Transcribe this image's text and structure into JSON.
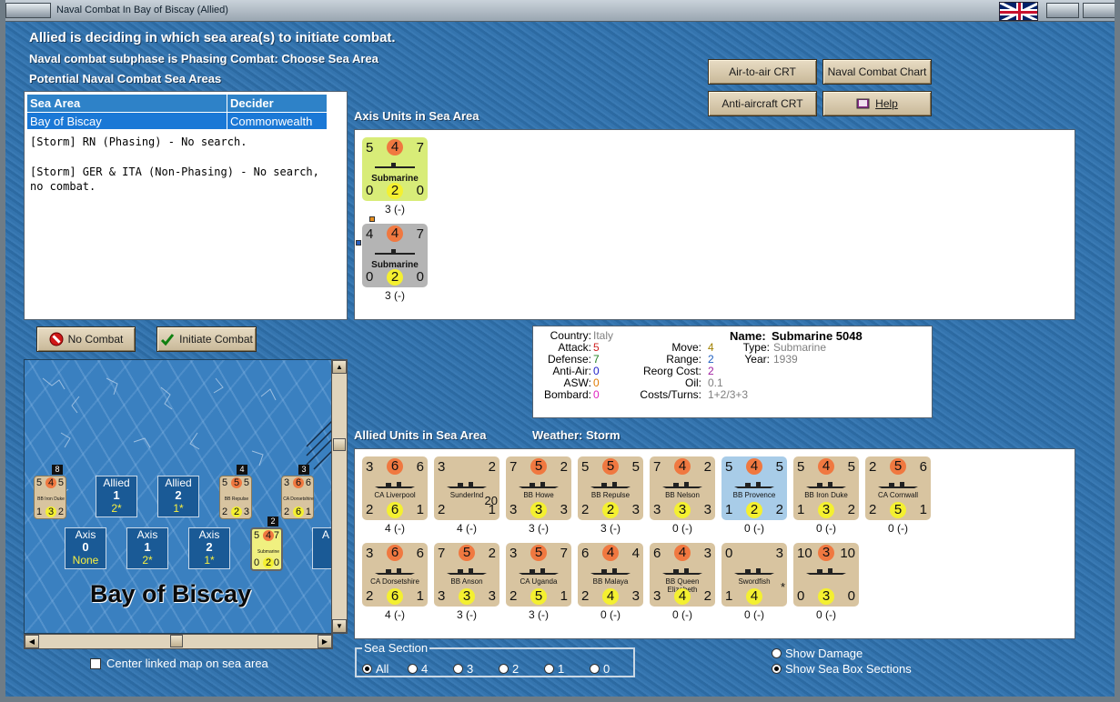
{
  "window": {
    "title": "Naval Combat In Bay of Biscay (Allied)"
  },
  "headings": {
    "line1": "Allied is deciding in which sea area(s) to initiate combat.",
    "line2": "Naval combat subphase is Phasing Combat: Choose Sea Area",
    "line3": "Potential Naval Combat Sea Areas"
  },
  "sea_table": {
    "headers": [
      "Sea Area",
      "Decider"
    ],
    "rows": [
      [
        "Bay of Biscay",
        "Commonwealth"
      ]
    ],
    "message1": "[Storm] RN (Phasing) - No search.",
    "message2": "[Storm] GER & ITA (Non-Phasing) - No search, no combat."
  },
  "buttons": {
    "air_to_air": "Air-to-air CRT",
    "naval_chart": "Naval Combat Chart",
    "anti_aircraft": "Anti-aircraft CRT",
    "help": "Help",
    "no_combat": "No Combat",
    "initiate": "Initiate Combat"
  },
  "axis": {
    "label": "Axis Units in Sea Area",
    "units": [
      {
        "atk": "5",
        "mid": "4",
        "rng": "7",
        "def": "0",
        "aa": "2",
        "br": "0",
        "name": "Submarine",
        "below": "3 (-)",
        "color": "#d8ec78"
      },
      {
        "atk": "4",
        "mid": "4",
        "rng": "7",
        "def": "0",
        "aa": "2",
        "br": "0",
        "name": "Submarine",
        "below": "3 (-)",
        "color": "#b4b4b4"
      }
    ]
  },
  "info": {
    "country_label": "Country:",
    "country": "Italy",
    "attack_label": "Attack:",
    "attack": "5",
    "defense_label": "Defense:",
    "defense": "7",
    "antiair_label": "Anti-Air:",
    "antiair": "0",
    "asw_label": "ASW:",
    "asw": "0",
    "bombard_label": "Bombard:",
    "bombard": "0",
    "move_label": "Move:",
    "move": "4",
    "range_label": "Range:",
    "range": "2",
    "reorg_label": "Reorg Cost:",
    "reorg": "2",
    "oil_label": "Oil:",
    "oil": "0.1",
    "costs_label": "Costs/Turns:",
    "costs": "1+2/3+3",
    "name_label": "Name:",
    "name": "Submarine 5048",
    "type_label": "Type:",
    "type": "Submarine",
    "year_label": "Year:",
    "year": "1939",
    "colors": {
      "attack": "#d02020",
      "defense": "#208020",
      "antiair": "#2020c8",
      "asw": "#e07a00",
      "bombard": "#e020c0",
      "move": "#a08000",
      "range": "#2060c0",
      "reorg": "#a020a0",
      "grey": "#808080"
    }
  },
  "allied": {
    "label": "Allied Units in Sea Area",
    "weather": "Weather:  Storm",
    "units": [
      {
        "tl": "3",
        "tc": "6",
        "tr": "6",
        "bl": "2",
        "bc": "6",
        "br": "1",
        "name": "CA Liverpool",
        "below": "4 (-)",
        "color": "#d8c4a0"
      },
      {
        "tl": "3",
        "tc": "",
        "tr": "2",
        "bl": "2",
        "bc": "",
        "br": "1",
        "name": "Sunderlnd",
        "below": "4 (-)",
        "color": "#d8c4a0",
        "extra": "20"
      },
      {
        "tl": "7",
        "tc": "5",
        "tr": "2",
        "bl": "3",
        "bc": "3",
        "br": "3",
        "name": "BB Howe",
        "below": "3 (-)",
        "color": "#d8c4a0"
      },
      {
        "tl": "5",
        "tc": "5",
        "tr": "5",
        "bl": "2",
        "bc": "2",
        "br": "3",
        "name": "BB Repulse",
        "below": "3 (-)",
        "color": "#d8c4a0"
      },
      {
        "tl": "7",
        "tc": "4",
        "tr": "2",
        "bl": "3",
        "bc": "3",
        "br": "3",
        "name": "BB Nelson",
        "below": "0 (-)",
        "color": "#d8c4a0"
      },
      {
        "tl": "5",
        "tc": "4",
        "tr": "5",
        "bl": "1",
        "bc": "2",
        "br": "2",
        "name": "BB Provence",
        "below": "0 (-)",
        "color": "#a8cce8"
      },
      {
        "tl": "5",
        "tc": "4",
        "tr": "5",
        "bl": "1",
        "bc": "3",
        "br": "2",
        "name": "BB Iron Duke",
        "below": "0 (-)",
        "color": "#d8c4a0"
      },
      {
        "tl": "2",
        "tc": "5",
        "tr": "6",
        "bl": "2",
        "bc": "5",
        "br": "1",
        "name": "CA Cornwall",
        "below": "0 (-)",
        "color": "#d8c4a0"
      },
      {
        "tl": "3",
        "tc": "6",
        "tr": "6",
        "bl": "2",
        "bc": "6",
        "br": "1",
        "name": "CA Dorsetshire",
        "below": "4 (-)",
        "color": "#d8c4a0"
      },
      {
        "tl": "7",
        "tc": "5",
        "tr": "2",
        "bl": "3",
        "bc": "3",
        "br": "3",
        "name": "BB Anson",
        "below": "3 (-)",
        "color": "#d8c4a0"
      },
      {
        "tl": "3",
        "tc": "5",
        "tr": "7",
        "bl": "2",
        "bc": "5",
        "br": "1",
        "name": "CA Uganda",
        "below": "3 (-)",
        "color": "#d8c4a0"
      },
      {
        "tl": "6",
        "tc": "4",
        "tr": "4",
        "bl": "2",
        "bc": "4",
        "br": "3",
        "name": "BB Malaya",
        "below": "0 (-)",
        "color": "#d8c4a0"
      },
      {
        "tl": "6",
        "tc": "4",
        "tr": "3",
        "bl": "3",
        "bc": "4",
        "br": "2",
        "name": "BB Queen Elizabeth",
        "below": "0 (-)",
        "color": "#d8c4a0"
      },
      {
        "tl": "0",
        "tc": "",
        "tr": "3",
        "bl": "1",
        "bc": "4",
        "br": "",
        "name": "Swordfish",
        "below": "0 (-)",
        "color": "#d8c4a0",
        "extra": "*"
      },
      {
        "tl": "10",
        "tc": "3",
        "tr": "10",
        "bl": "0",
        "bc": "3",
        "br": "0",
        "name": "",
        "below": "0 (-)",
        "color": "#d8c4a0"
      }
    ]
  },
  "map": {
    "name": "Bay of Biscay",
    "allied_boxes": [
      {
        "side": "Allied",
        "num": "1",
        "sub": "2*"
      },
      {
        "side": "Allied",
        "num": "2",
        "sub": "1*"
      }
    ],
    "axis_boxes": [
      {
        "side": "Axis",
        "num": "0",
        "sub": "None"
      },
      {
        "side": "Axis",
        "num": "1",
        "sub": "2*"
      },
      {
        "side": "Axis",
        "num": "2",
        "sub": "1*"
      }
    ],
    "partial_box": "A",
    "minis": [
      {
        "tl": "5",
        "tc": "4",
        "tr": "5",
        "bl": "1",
        "bc": "3",
        "br": "2",
        "name": "BB Iron Duke",
        "stack": "8"
      },
      {
        "tl": "5",
        "tc": "5",
        "tr": "5",
        "bl": "2",
        "bc": "2",
        "br": "3",
        "name": "BB Repulse",
        "stack": "4"
      },
      {
        "tl": "3",
        "tc": "6",
        "tr": "6",
        "bl": "2",
        "bc": "6",
        "br": "1",
        "name": "CA Dorsetshire",
        "stack": "3"
      },
      {
        "tl": "5",
        "tc": "4",
        "tr": "7",
        "bl": "0",
        "bc": "2",
        "br": "0",
        "name": "Submarine",
        "stack": "2"
      }
    ]
  },
  "center_linked": "Center linked map on sea area",
  "sea_section": {
    "label": "Sea Section",
    "options": [
      "All",
      "4",
      "3",
      "2",
      "1",
      "0"
    ],
    "selected": "All"
  },
  "show_options": [
    "Show Damage",
    "Show Sea Box Sections"
  ],
  "show_selected": "Show Sea Box Sections"
}
